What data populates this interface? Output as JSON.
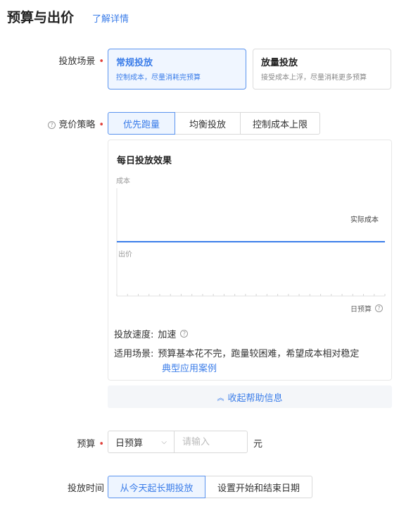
{
  "header": {
    "title": "预算与出价",
    "learn_more": "了解详情"
  },
  "scene": {
    "label": "投放场景",
    "required_mark": "•",
    "options": [
      {
        "title": "常规投放",
        "desc": "控制成本，尽量消耗完预算",
        "selected": true
      },
      {
        "title": "放量投放",
        "desc": "接受成本上浮，尽量消耗更多预算",
        "selected": false
      }
    ]
  },
  "bid_strategy": {
    "label": "竞价策略",
    "required_mark": "•",
    "options": [
      "优先跑量",
      "均衡投放",
      "控制成本上限"
    ],
    "selected_index": 0
  },
  "help": {
    "chart_data": {
      "type": "line",
      "title": "每日投放效果",
      "ylabel_top": "成本",
      "ylabel_bottom": "出价",
      "xlabel": "日预算",
      "series": [
        {
          "name": "实际成本",
          "values": [
            1,
            1
          ],
          "color": "#3b7de9"
        }
      ]
    },
    "speed_label": "投放速度:",
    "speed_value": "加速",
    "scene_label": "适用场景:",
    "scene_value": "预算基本花不完，跑量较困难，希望成本相对稳定",
    "case_link": "典型应用案例",
    "collapse_label": "收起帮助信息"
  },
  "budget": {
    "label": "预算",
    "required_mark": "•",
    "type_value": "日预算",
    "input_placeholder": "请输入",
    "unit": "元"
  },
  "schedule": {
    "label": "投放时间",
    "options": [
      "从今天起长期投放",
      "设置开始和结束日期"
    ],
    "selected_index": 0
  },
  "colors": {
    "accent": "#3b7de9",
    "required": "#e0403a",
    "border": "#d9d9d9"
  }
}
